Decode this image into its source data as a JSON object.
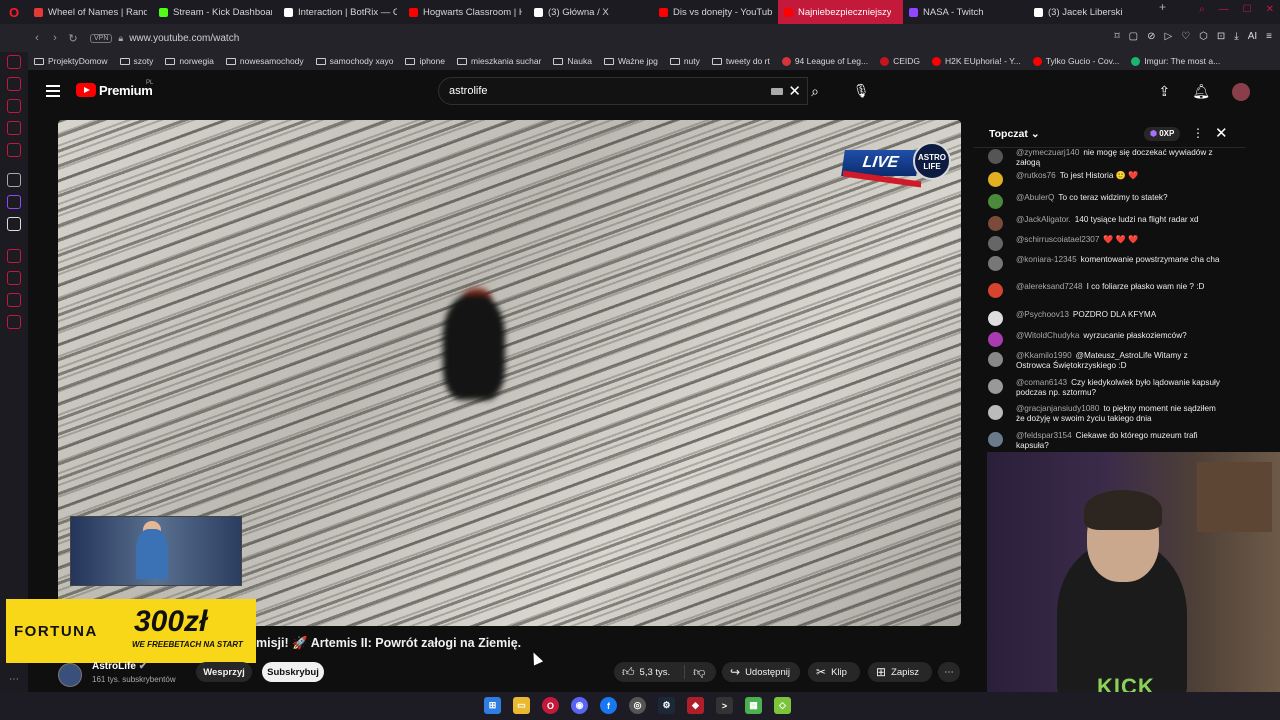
{
  "browser": {
    "tabs": [
      {
        "label": "Wheel of Names | Rando",
        "color": "#e53935",
        "active": false
      },
      {
        "label": "Stream - Kick Dashboard",
        "color": "#53fc18",
        "active": false
      },
      {
        "label": "Interaction | BotRix — Cl",
        "color": "#ffffff",
        "active": false
      },
      {
        "label": "Hogwarts Classroom | Ha",
        "color": "#ff0000",
        "active": false
      },
      {
        "label": "(3) Główna / X",
        "color": "#ffffff",
        "active": false
      },
      {
        "label": "Dis vs donejty - YouTube",
        "color": "#ff0000",
        "active": false
      },
      {
        "label": "Najniebezpieczniejszy",
        "color": "#ff0000",
        "active": true
      },
      {
        "label": "NASA - Twitch",
        "color": "#9146ff",
        "active": false
      },
      {
        "label": "(3) Jacek Liberski",
        "color": "#ffffff",
        "active": false
      }
    ],
    "vpn_label": "VPN",
    "url": "www.youtube.com/watch",
    "ai_label": "AI",
    "bookmarks": [
      {
        "label": "ProjektyDomow",
        "type": "folder"
      },
      {
        "label": "szoty",
        "type": "folder"
      },
      {
        "label": "norwegia",
        "type": "folder"
      },
      {
        "label": "nowesamochody",
        "type": "folder"
      },
      {
        "label": "samochody xayo",
        "type": "folder"
      },
      {
        "label": "iphone",
        "type": "folder"
      },
      {
        "label": "mieszkania suchar",
        "type": "folder"
      },
      {
        "label": "Nauka",
        "type": "folder"
      },
      {
        "label": "Ważne jpg",
        "type": "folder"
      },
      {
        "label": "nuty",
        "type": "folder"
      },
      {
        "label": "tweety do rt",
        "type": "folder"
      },
      {
        "label": "94 League of Leg...",
        "type": "site",
        "color": "#d13639"
      },
      {
        "label": "CEIDG",
        "type": "site",
        "color": "#c4161c"
      },
      {
        "label": "H2K EUphoria! - Y...",
        "type": "site",
        "color": "#ff0000"
      },
      {
        "label": "Tylko Gucio - Cov...",
        "type": "site",
        "color": "#ff0000"
      },
      {
        "label": "Imgur: The most a...",
        "type": "site",
        "color": "#1bb76e"
      }
    ]
  },
  "youtube": {
    "brand": "Premium",
    "country": "PL",
    "search_value": "astrolife",
    "video": {
      "live_badge": "LIVE",
      "channel_badge": "ASTRO LIFE"
    },
    "title": "misji! 🚀 Artemis II: Powrót załogi na Ziemię.",
    "channel": {
      "name": "AstroLife",
      "subscribers": "161 tys. subskrybentów"
    },
    "buttons": {
      "support": "Wesprzyj",
      "subscribe": "Subskrybuj",
      "likes": "5,3 tys.",
      "share": "Udostępnij",
      "clip": "Klip",
      "save": "Zapisz"
    },
    "ad": {
      "brand": "FORTUNA",
      "amount": "300zł",
      "tagline": "WE FREEBETACH NA START"
    }
  },
  "chat": {
    "title": "Topczat",
    "xp": "0XP",
    "messages": [
      {
        "author": "@zymeczuarj140",
        "text": "nie mogę się doczekać wywiadów z załogą",
        "color": "#555"
      },
      {
        "author": "@rutkos76",
        "text": "To jest Historia 🙂 ❤️",
        "color": "#e0b020"
      },
      {
        "author": "@AbulerQ",
        "text": "To co teraz widzimy to statek?",
        "color": "#4a8a3a"
      },
      {
        "author": "@JackAligator.",
        "text": "140 tysiące ludzi na flight radar xd",
        "color": "#7a4a3a"
      },
      {
        "author": "@schirruscoiatael2307",
        "text": "❤️ ❤️ ❤️",
        "color": "#666"
      },
      {
        "author": "@koniara-12345",
        "text": "komentowanie powstrzymane cha cha",
        "color": "#777"
      },
      {
        "author": "@alereksand7248",
        "text": "I co foliarze płasko wam nie ? :D",
        "color": "#d8432e"
      },
      {
        "author": "@Psychoov13",
        "text": "POZDRO DLA KFYMA",
        "color": "#ddd"
      },
      {
        "author": "@WitoldChudyka",
        "text": "wyrzucanie płaskoziemców?",
        "color": "#a93ab0"
      },
      {
        "author": "@Kkamilo1990",
        "text": "@Mateusz_AstroLife Witamy z Ostrowca Świętokrzyskiego :D",
        "color": "#888"
      },
      {
        "author": "@coman6143",
        "text": "Czy kiedykolwiek było lądowanie kapsuły podczas np. sztormu?",
        "color": "#999"
      },
      {
        "author": "@gracjanjansiudy1080",
        "text": "to piękny moment nie sądziłem że dożyję w swoim życiu takiego dnia",
        "color": "#bbb"
      },
      {
        "author": "@feldspar3154",
        "text": "Ciekawe do którego muzeum trafi kapsuła?",
        "color": "#6a7a8a"
      }
    ]
  },
  "webcam": {
    "shirt_text": "KICK"
  }
}
